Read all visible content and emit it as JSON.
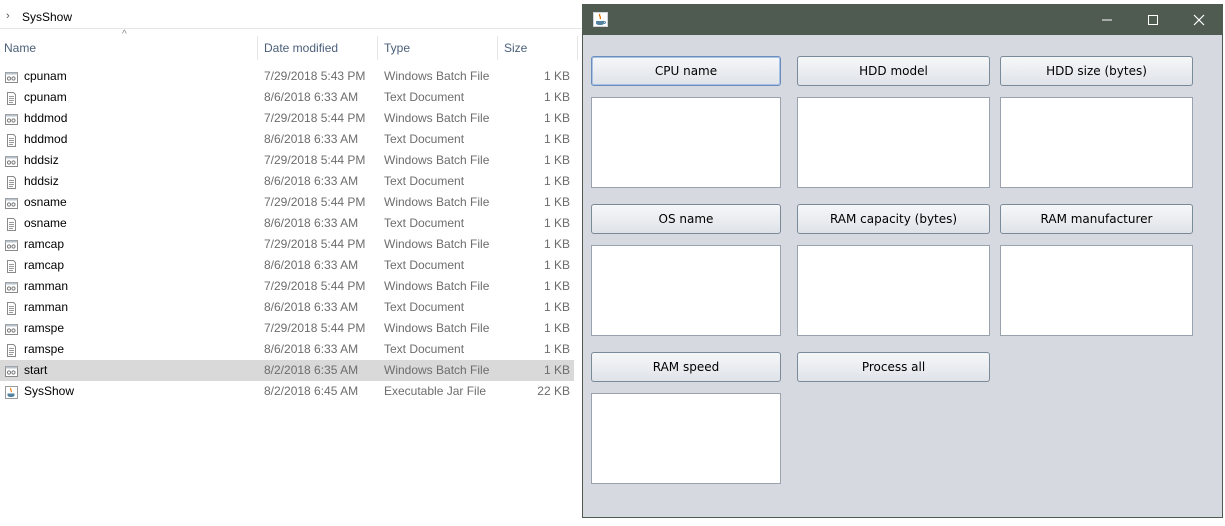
{
  "explorer": {
    "breadcrumb": "SysShow",
    "columns": {
      "name": "Name",
      "date": "Date modified",
      "type": "Type",
      "size": "Size"
    },
    "files": [
      {
        "name": "cpunam",
        "date": "7/29/2018 5:43 PM",
        "type": "Windows Batch File",
        "size": "1 KB",
        "icon": "batch-file-icon"
      },
      {
        "name": "cpunam",
        "date": "8/6/2018 6:33 AM",
        "type": "Text Document",
        "size": "1 KB",
        "icon": "text-file-icon"
      },
      {
        "name": "hddmod",
        "date": "7/29/2018 5:44 PM",
        "type": "Windows Batch File",
        "size": "1 KB",
        "icon": "batch-file-icon"
      },
      {
        "name": "hddmod",
        "date": "8/6/2018 6:33 AM",
        "type": "Text Document",
        "size": "1 KB",
        "icon": "text-file-icon"
      },
      {
        "name": "hddsiz",
        "date": "7/29/2018 5:44 PM",
        "type": "Windows Batch File",
        "size": "1 KB",
        "icon": "batch-file-icon"
      },
      {
        "name": "hddsiz",
        "date": "8/6/2018 6:33 AM",
        "type": "Text Document",
        "size": "1 KB",
        "icon": "text-file-icon"
      },
      {
        "name": "osname",
        "date": "7/29/2018 5:44 PM",
        "type": "Windows Batch File",
        "size": "1 KB",
        "icon": "batch-file-icon"
      },
      {
        "name": "osname",
        "date": "8/6/2018 6:33 AM",
        "type": "Text Document",
        "size": "1 KB",
        "icon": "text-file-icon"
      },
      {
        "name": "ramcap",
        "date": "7/29/2018 5:44 PM",
        "type": "Windows Batch File",
        "size": "1 KB",
        "icon": "batch-file-icon"
      },
      {
        "name": "ramcap",
        "date": "8/6/2018 6:33 AM",
        "type": "Text Document",
        "size": "1 KB",
        "icon": "text-file-icon"
      },
      {
        "name": "ramman",
        "date": "7/29/2018 5:44 PM",
        "type": "Windows Batch File",
        "size": "1 KB",
        "icon": "batch-file-icon"
      },
      {
        "name": "ramman",
        "date": "8/6/2018 6:33 AM",
        "type": "Text Document",
        "size": "1 KB",
        "icon": "text-file-icon"
      },
      {
        "name": "ramspe",
        "date": "7/29/2018 5:44 PM",
        "type": "Windows Batch File",
        "size": "1 KB",
        "icon": "batch-file-icon"
      },
      {
        "name": "ramspe",
        "date": "8/6/2018 6:33 AM",
        "type": "Text Document",
        "size": "1 KB",
        "icon": "text-file-icon"
      },
      {
        "name": "start",
        "date": "8/2/2018 6:35 AM",
        "type": "Windows Batch File",
        "size": "1 KB",
        "icon": "batch-file-icon",
        "selected": true
      },
      {
        "name": "SysShow",
        "date": "8/2/2018 6:45 AM",
        "type": "Executable Jar File",
        "size": "22 KB",
        "icon": "jar-file-icon"
      }
    ]
  },
  "sysshow": {
    "app_icon": "java-cup-icon",
    "buttons": {
      "cpu_name": "CPU name",
      "hdd_model": "HDD model",
      "hdd_size": "HDD size (bytes)",
      "os_name": "OS name",
      "ram_capacity": "RAM capacity (bytes)",
      "ram_manufacturer": "RAM manufacturer",
      "ram_speed": "RAM speed",
      "process_all": "Process all"
    },
    "outputs": {
      "cpu_name": "",
      "hdd_model": "",
      "hdd_size": "",
      "os_name": "",
      "ram_capacity": "",
      "ram_manufacturer": "",
      "ram_speed": ""
    }
  },
  "colors": {
    "titlebar": "#4f5a50",
    "window_bg": "#d6d9df",
    "selected_row": "#d9d9d9",
    "header_text": "#4c607a"
  }
}
